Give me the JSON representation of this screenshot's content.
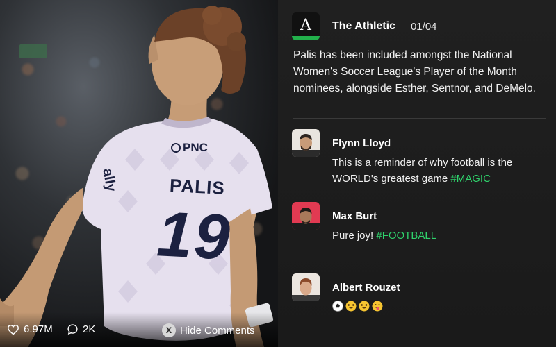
{
  "media": {
    "shirt": {
      "sponsor": "PNC",
      "name": "PALIS",
      "number": "19",
      "sleeve": "ally"
    },
    "likes_count": "6.97M",
    "comments_count": "2K",
    "hide_comments_button": {
      "key": "X",
      "label": "Hide Comments"
    }
  },
  "post": {
    "source_name": "The Athletic",
    "source_logo_letter": "A",
    "page_indicator": "01/04",
    "headline": "Palis has been included amongst the National Women's Soccer League's Player of the Month nominees, alongside Esther, Sentnor, and DeMelo."
  },
  "comments": [
    {
      "author": "Flynn Lloyd",
      "text": "This is a reminder of why football is the WORLD's greatest game ",
      "hashtag": "#MAGIC"
    },
    {
      "author": "Max Burt",
      "text": "Pure joy! ",
      "hashtag": "#FOOTBALL"
    },
    {
      "author": "Albert Rouzet",
      "emojis": [
        "soccer-ball",
        "grinning-squinting-face",
        "grinning-squinting-face",
        "face-with-tongue"
      ]
    }
  ],
  "colors": {
    "accent_green": "#2fd16b",
    "panel_bg": "#1d1d1d",
    "logo_stripe": "#22b04b"
  }
}
